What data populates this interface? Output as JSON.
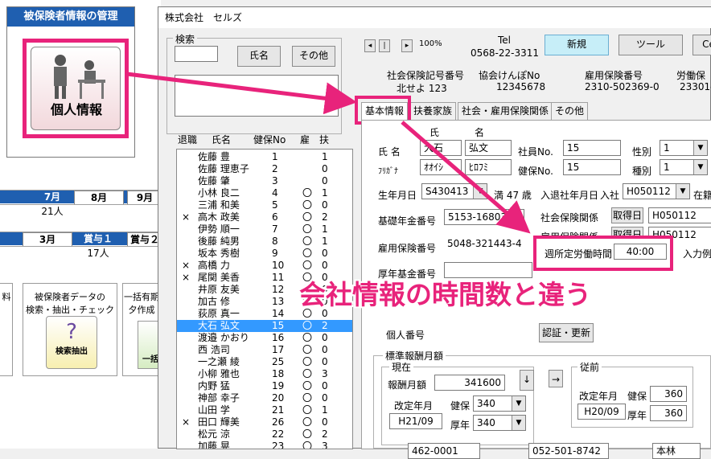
{
  "left": {
    "mgmt_title": "被保険者情報の管理",
    "personal_info_button": "個人情報",
    "month_headers": [
      "7月",
      "8月",
      "9月"
    ],
    "month_values": [
      "21人",
      "",
      ""
    ],
    "bonus_headers": [
      "3月",
      "賞与１",
      "賞与２"
    ],
    "bonus_values": [
      "",
      "17人",
      ""
    ],
    "tile1_text": "料",
    "tile2_line1": "被保険者データの",
    "tile2_line2": "検索・抽出・チェック",
    "tile2_button": "検索抽出",
    "tile3_line1": "一括有期",
    "tile3_line2": "夕作成",
    "tile3_button": "一括"
  },
  "dialog": {
    "title": "株式会社　セルズ",
    "search": {
      "label": "検索",
      "name_button": "氏名",
      "other_button": "その他"
    },
    "nav": {
      "first": "◂",
      "prev": "|",
      "next": "▸",
      "zoom": "100%"
    },
    "tel_label": "Tel",
    "tel_value": "0568-22-3311",
    "new_button": "新規",
    "tool_button": "ツール",
    "close_button": "Ce",
    "header_info": [
      {
        "label": "社会保険記号番号",
        "value": "北せよ 123"
      },
      {
        "label": "協会けんぽNo",
        "value": "12345678"
      },
      {
        "label": "雇用保険番号",
        "value": "2310-502369-0"
      },
      {
        "label": "労働保",
        "value": "23301-"
      }
    ],
    "list_headers": {
      "retire": "退職",
      "name": "氏名",
      "kenpo": "健保No",
      "koyo": "雇",
      "fu": "扶"
    },
    "employees": [
      {
        "retire": "",
        "name": "佐藤 豊",
        "no": "1",
        "koyo": "",
        "fu": "1"
      },
      {
        "retire": "",
        "name": "佐藤 理恵子",
        "no": "2",
        "koyo": "",
        "fu": "0"
      },
      {
        "retire": "",
        "name": "佐藤 肇",
        "no": "3",
        "koyo": "",
        "fu": "0"
      },
      {
        "retire": "",
        "name": "小林 良二",
        "no": "4",
        "koyo": "〇",
        "fu": "1"
      },
      {
        "retire": "",
        "name": "三浦 和美",
        "no": "5",
        "koyo": "〇",
        "fu": "0"
      },
      {
        "retire": "×",
        "name": "高木 政美",
        "no": "6",
        "koyo": "〇",
        "fu": "2"
      },
      {
        "retire": "",
        "name": "伊勢 順一",
        "no": "7",
        "koyo": "〇",
        "fu": "1"
      },
      {
        "retire": "",
        "name": "後藤 純男",
        "no": "8",
        "koyo": "〇",
        "fu": "1"
      },
      {
        "retire": "",
        "name": "坂本 秀樹",
        "no": "9",
        "koyo": "〇",
        "fu": "0"
      },
      {
        "retire": "×",
        "name": "高橋 力",
        "no": "10",
        "koyo": "〇",
        "fu": "0"
      },
      {
        "retire": "×",
        "name": "尾関 美香",
        "no": "11",
        "koyo": "〇",
        "fu": "0"
      },
      {
        "retire": "",
        "name": "井原 友美",
        "no": "12",
        "koyo": "〇",
        "fu": "0"
      },
      {
        "retire": "",
        "name": "加古 修",
        "no": "13",
        "koyo": "〇",
        "fu": "0"
      },
      {
        "retire": "",
        "name": "荻原 真一",
        "no": "14",
        "koyo": "〇",
        "fu": "0"
      },
      {
        "retire": "",
        "name": "大石 弘文",
        "no": "15",
        "koyo": "〇",
        "fu": "2"
      },
      {
        "retire": "",
        "name": "渡邉 かおり",
        "no": "16",
        "koyo": "〇",
        "fu": "0"
      },
      {
        "retire": "",
        "name": "西 浩司",
        "no": "17",
        "koyo": "〇",
        "fu": "0"
      },
      {
        "retire": "",
        "name": "一之瀬 綾",
        "no": "25",
        "koyo": "〇",
        "fu": "0"
      },
      {
        "retire": "",
        "name": "小柳 雅也",
        "no": "18",
        "koyo": "〇",
        "fu": "3"
      },
      {
        "retire": "",
        "name": "内野 猛",
        "no": "19",
        "koyo": "〇",
        "fu": "0"
      },
      {
        "retire": "",
        "name": "神部 幸子",
        "no": "20",
        "koyo": "〇",
        "fu": "0"
      },
      {
        "retire": "",
        "name": "山田 学",
        "no": "21",
        "koyo": "〇",
        "fu": "1"
      },
      {
        "retire": "×",
        "name": "田口 輝美",
        "no": "26",
        "koyo": "〇",
        "fu": "0"
      },
      {
        "retire": "",
        "name": "松元 涼",
        "no": "22",
        "koyo": "〇",
        "fu": "2"
      },
      {
        "retire": "",
        "name": "加藤 晃",
        "no": "23",
        "koyo": "〇",
        "fu": "3"
      }
    ],
    "tabs": [
      "基本情報",
      "扶養家族",
      "社会・雇用保険関係",
      "その他"
    ],
    "form": {
      "sei_header": "氏",
      "mei_header": "名",
      "name_label": "氏 名",
      "sei": "大石",
      "mei": "弘文",
      "furigana_label": "ﾌﾘｶﾞﾅ",
      "furi_sei": "ｵｵｲｼ",
      "furi_mei": "ﾋﾛﾌﾐ",
      "shain_no_label": "社員No.",
      "shain_no": "15",
      "kenpo_no_label": "健保No.",
      "kenpo_no": "15",
      "gender_label": "性別",
      "gender": "1",
      "kind_label": "種別",
      "kind": "1",
      "birth_label": "生年月日",
      "birth": "S430413",
      "age": "満 47 歳",
      "join_label": "入退社年月日",
      "join_prefix": "入社",
      "join": "H050112",
      "status": "在籍",
      "pension_label": "基礎年金番号",
      "pension": "5153-168031",
      "social_label": "社会保険関係",
      "acquired_btn": "取得日",
      "social_date": "H050112",
      "koyo_rel_label": "雇用保険関係",
      "acquired_btn2": "取得日",
      "koyo_date": "H050112",
      "koyo_no_label": "雇用保険番号",
      "koyo_no": "5048-321443-4",
      "hours_label": "週所定労働時間",
      "hours": "40:00",
      "input_example": "入力例",
      "kousei_label": "厚年基金番号",
      "kousei": "",
      "my_number_label": "個人番号",
      "verify_button": "認証・更新",
      "std_label": "標準報酬月額",
      "current_label": "現在",
      "monthly_label": "報酬月額",
      "monthly": "341600",
      "down_arrow": "↓",
      "right_arrow": "→",
      "revision_label": "改定年月",
      "revision": "H21/09",
      "kenpo_label": "健保",
      "kenpo_grade": "340",
      "kounen_label": "厚年",
      "kounen_grade": "340",
      "prev_label": "従前",
      "prev_revision_label": "改定年月",
      "prev_revision": "H20/09",
      "prev_kenpo_label": "健保",
      "prev_kenpo": "360",
      "prev_kounen_label": "厚年",
      "prev_kounen": "360",
      "bottom_zip": "462-0001",
      "bottom_tel": "052-501-8742",
      "bottom_name": "本林"
    }
  },
  "annotation": "会社情報の時間数と違う",
  "colors": {
    "accent": "#e8237b",
    "header_blue": "#1f5fb0",
    "selection": "#3399ff"
  }
}
